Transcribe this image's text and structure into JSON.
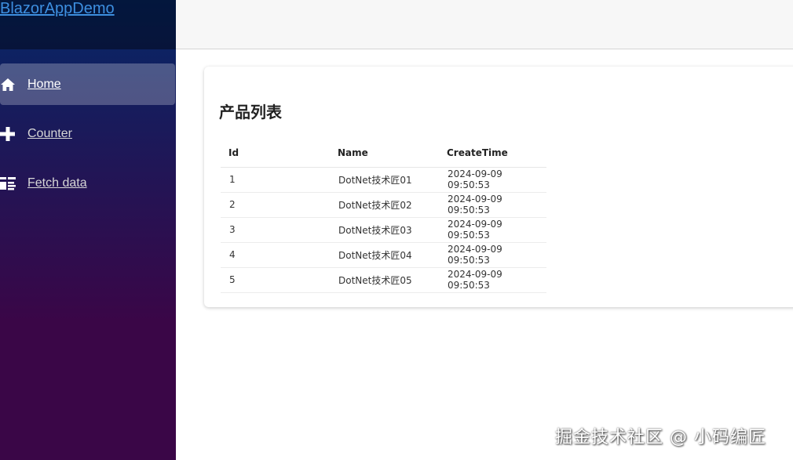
{
  "brand": "BlazorAppDemo",
  "nav": [
    {
      "label": "Home",
      "icon": "home-icon",
      "active": true
    },
    {
      "label": "Counter",
      "icon": "plus-icon",
      "active": false
    },
    {
      "label": "Fetch data",
      "icon": "list-icon",
      "active": false
    }
  ],
  "page": {
    "title": "产品列表",
    "table": {
      "headers": [
        "Id",
        "Name",
        "CreateTime"
      ],
      "rows": [
        [
          "1",
          "DotNet技术匠01",
          "2024-09-09 09:50:53"
        ],
        [
          "2",
          "DotNet技术匠02",
          "2024-09-09 09:50:53"
        ],
        [
          "3",
          "DotNet技术匠03",
          "2024-09-09 09:50:53"
        ],
        [
          "4",
          "DotNet技术匠04",
          "2024-09-09 09:50:53"
        ],
        [
          "5",
          "DotNet技术匠05",
          "2024-09-09 09:50:53"
        ]
      ]
    }
  },
  "watermark": "掘金技术社区 @ 小码编匠",
  "colors": {
    "sidebar_top": "#052767",
    "sidebar_bottom": "#3a0647",
    "brand_link": "#3d8fe0",
    "topbar": "#f7f7f7"
  }
}
